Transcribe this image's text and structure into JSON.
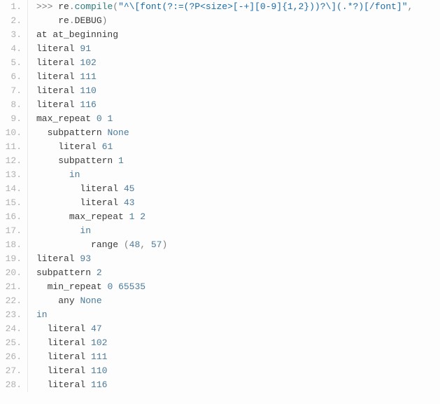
{
  "lines": [
    {
      "num": "1.",
      "indent": "",
      "tokens": [
        {
          "cls": "op",
          "t": ">>> "
        },
        {
          "cls": "ident",
          "t": "re"
        },
        {
          "cls": "dot",
          "t": "."
        },
        {
          "cls": "fn",
          "t": "compile"
        },
        {
          "cls": "paren",
          "t": "("
        },
        {
          "cls": "str",
          "t": "\"^\\[font(?:=(?P<size>[-+][0-9]{1,2}))?\\](.*?)[/font]\""
        },
        {
          "cls": "paren",
          "t": ","
        }
      ]
    },
    {
      "num": "2.",
      "indent": "    ",
      "tokens": [
        {
          "cls": "ident",
          "t": "re"
        },
        {
          "cls": "dot",
          "t": "."
        },
        {
          "cls": "ident",
          "t": "DEBUG"
        },
        {
          "cls": "paren",
          "t": ")"
        }
      ]
    },
    {
      "num": "3.",
      "indent": "",
      "tokens": [
        {
          "cls": "ident",
          "t": "at at_beginning"
        }
      ]
    },
    {
      "num": "4.",
      "indent": "",
      "tokens": [
        {
          "cls": "ident",
          "t": "literal "
        },
        {
          "cls": "num",
          "t": "91"
        }
      ]
    },
    {
      "num": "5.",
      "indent": "",
      "tokens": [
        {
          "cls": "ident",
          "t": "literal "
        },
        {
          "cls": "num",
          "t": "102"
        }
      ]
    },
    {
      "num": "6.",
      "indent": "",
      "tokens": [
        {
          "cls": "ident",
          "t": "literal "
        },
        {
          "cls": "num",
          "t": "111"
        }
      ]
    },
    {
      "num": "7.",
      "indent": "",
      "tokens": [
        {
          "cls": "ident",
          "t": "literal "
        },
        {
          "cls": "num",
          "t": "110"
        }
      ]
    },
    {
      "num": "8.",
      "indent": "",
      "tokens": [
        {
          "cls": "ident",
          "t": "literal "
        },
        {
          "cls": "num",
          "t": "116"
        }
      ]
    },
    {
      "num": "9.",
      "indent": "",
      "tokens": [
        {
          "cls": "ident",
          "t": "max_repeat "
        },
        {
          "cls": "num",
          "t": "0"
        },
        {
          "cls": "ident",
          "t": " "
        },
        {
          "cls": "num",
          "t": "1"
        }
      ]
    },
    {
      "num": "10.",
      "indent": "  ",
      "tokens": [
        {
          "cls": "ident",
          "t": "subpattern "
        },
        {
          "cls": "kw",
          "t": "None"
        }
      ]
    },
    {
      "num": "11.",
      "indent": "    ",
      "tokens": [
        {
          "cls": "ident",
          "t": "literal "
        },
        {
          "cls": "num",
          "t": "61"
        }
      ]
    },
    {
      "num": "12.",
      "indent": "    ",
      "tokens": [
        {
          "cls": "ident",
          "t": "subpattern "
        },
        {
          "cls": "num",
          "t": "1"
        }
      ]
    },
    {
      "num": "13.",
      "indent": "      ",
      "tokens": [
        {
          "cls": "kw",
          "t": "in"
        }
      ]
    },
    {
      "num": "14.",
      "indent": "        ",
      "tokens": [
        {
          "cls": "ident",
          "t": "literal "
        },
        {
          "cls": "num",
          "t": "45"
        }
      ]
    },
    {
      "num": "15.",
      "indent": "        ",
      "tokens": [
        {
          "cls": "ident",
          "t": "literal "
        },
        {
          "cls": "num",
          "t": "43"
        }
      ]
    },
    {
      "num": "16.",
      "indent": "      ",
      "tokens": [
        {
          "cls": "ident",
          "t": "max_repeat "
        },
        {
          "cls": "num",
          "t": "1"
        },
        {
          "cls": "ident",
          "t": " "
        },
        {
          "cls": "num",
          "t": "2"
        }
      ]
    },
    {
      "num": "17.",
      "indent": "        ",
      "tokens": [
        {
          "cls": "kw",
          "t": "in"
        }
      ]
    },
    {
      "num": "18.",
      "indent": "          ",
      "tokens": [
        {
          "cls": "ident",
          "t": "range "
        },
        {
          "cls": "paren",
          "t": "("
        },
        {
          "cls": "num",
          "t": "48"
        },
        {
          "cls": "paren",
          "t": ", "
        },
        {
          "cls": "num",
          "t": "57"
        },
        {
          "cls": "paren",
          "t": ")"
        }
      ]
    },
    {
      "num": "19.",
      "indent": "",
      "tokens": [
        {
          "cls": "ident",
          "t": "literal "
        },
        {
          "cls": "num",
          "t": "93"
        }
      ]
    },
    {
      "num": "20.",
      "indent": "",
      "tokens": [
        {
          "cls": "ident",
          "t": "subpattern "
        },
        {
          "cls": "num",
          "t": "2"
        }
      ]
    },
    {
      "num": "21.",
      "indent": "  ",
      "tokens": [
        {
          "cls": "ident",
          "t": "min_repeat "
        },
        {
          "cls": "num",
          "t": "0"
        },
        {
          "cls": "ident",
          "t": " "
        },
        {
          "cls": "num",
          "t": "65535"
        }
      ]
    },
    {
      "num": "22.",
      "indent": "    ",
      "tokens": [
        {
          "cls": "ident",
          "t": "any "
        },
        {
          "cls": "kw",
          "t": "None"
        }
      ]
    },
    {
      "num": "23.",
      "indent": "",
      "tokens": [
        {
          "cls": "kw",
          "t": "in"
        }
      ]
    },
    {
      "num": "24.",
      "indent": "  ",
      "tokens": [
        {
          "cls": "ident",
          "t": "literal "
        },
        {
          "cls": "num",
          "t": "47"
        }
      ]
    },
    {
      "num": "25.",
      "indent": "  ",
      "tokens": [
        {
          "cls": "ident",
          "t": "literal "
        },
        {
          "cls": "num",
          "t": "102"
        }
      ]
    },
    {
      "num": "26.",
      "indent": "  ",
      "tokens": [
        {
          "cls": "ident",
          "t": "literal "
        },
        {
          "cls": "num",
          "t": "111"
        }
      ]
    },
    {
      "num": "27.",
      "indent": "  ",
      "tokens": [
        {
          "cls": "ident",
          "t": "literal "
        },
        {
          "cls": "num",
          "t": "110"
        }
      ]
    },
    {
      "num": "28.",
      "indent": "  ",
      "tokens": [
        {
          "cls": "ident",
          "t": "literal "
        },
        {
          "cls": "num",
          "t": "116"
        }
      ]
    }
  ]
}
